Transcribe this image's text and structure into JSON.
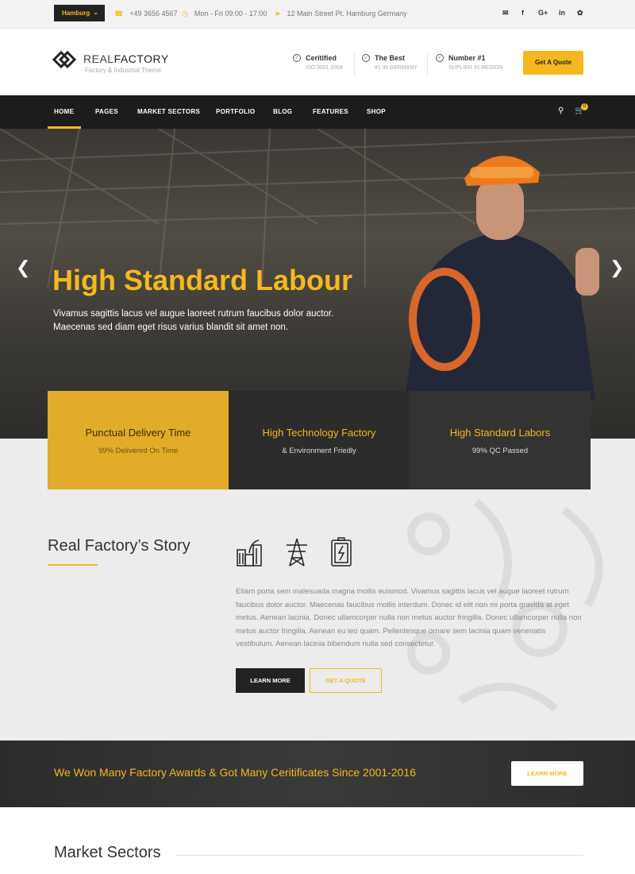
{
  "topbar": {
    "city": "Hamburg",
    "phone": "+49 3656 4567",
    "hours": "Mon - Fri 09:00 - 17:00",
    "address": "12 Main Street Pt. Hamburg Germany",
    "social_icons": [
      "mail-icon",
      "facebook-icon",
      "google-plus-icon",
      "linkedin-icon",
      "twitter-icon"
    ]
  },
  "header": {
    "logo_part1": "REAL",
    "logo_part2": "FACTORY",
    "tagline": "Factory & Industrial Theme",
    "features": [
      {
        "title": "Ceritified",
        "subtitle": "ISO 9001:2008"
      },
      {
        "title": "The Best",
        "subtitle": "#1 IN GERMANY"
      },
      {
        "title": "Number #1",
        "subtitle": "SUPLIER IN REGION"
      }
    ],
    "quote_button": "Get A Quote"
  },
  "nav": {
    "items": [
      "HOME",
      "PAGES",
      "MARKET SECTORS",
      "PORTFOLIO",
      "BLOG",
      "FEATURES",
      "SHOP"
    ],
    "cart_count": "0"
  },
  "hero": {
    "title": "High Standard Labour",
    "subtitle_line1": "Vivamus sagittis lacus vel augue laoreet rutrum faucibus dolor auctor.",
    "subtitle_line2": "Maecenas sed diam eget risus varius blandit sit amet non."
  },
  "feature_boxes": [
    {
      "title": "Punctual Delivery Time",
      "subtitle": "99% Delivered On Time"
    },
    {
      "title": "High Technology Factory",
      "subtitle": "& Environment Friedly"
    },
    {
      "title": "High Standard Labors",
      "subtitle": "99% QC Passed"
    }
  ],
  "story": {
    "title": "Real Factory’s Story",
    "icons": [
      "factory-icon",
      "power-tower-icon",
      "battery-icon"
    ],
    "text": "Etiam porta sem malesuada magna mollis euismod. Vivamus sagittis lacus vel augue laoreet rutrum faucibus dolor auctor. Maecenas faucibus mollis interdum. Donec id elit non mi porta gravida at eget metus. Aenean lacinia. Donec ullamcorper nulla non metus auctor fringilla. Donec ullamcorper nulla non metus auctor fringilla. Aenean eu leo quam. Pellentesque ornare sem lacinia quam venenatis vestibulum. Aenean lacinia bibendum nulla sed consectetur.",
    "learn_more": "LEARN MORE",
    "get_quote": "GET A QUOTE"
  },
  "awards": {
    "text": "We Won Many Factory Awards & Got Many Ceritificates Since 2001-2016",
    "button": "LEARN MORE"
  },
  "market": {
    "title": "Market Sectors"
  },
  "colors": {
    "accent": "#f5b820",
    "dark": "#1c1c1c"
  }
}
